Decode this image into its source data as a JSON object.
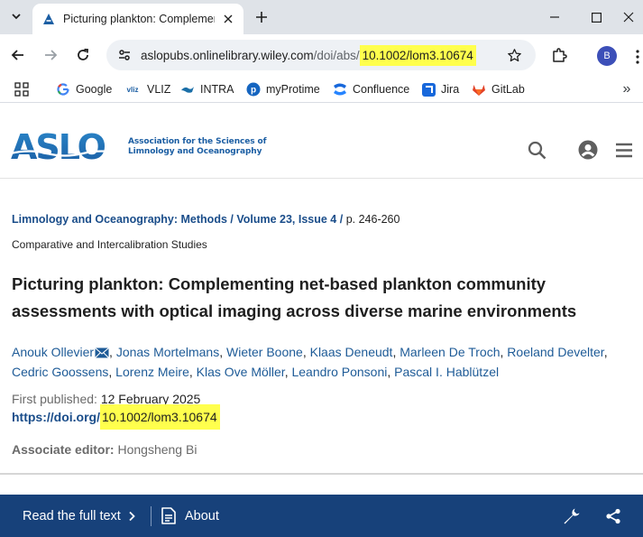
{
  "browser": {
    "tab": {
      "title": "Picturing plankton: Complemen",
      "favicon": "aslo-a-icon"
    },
    "address_bar": {
      "url_host": "aslopubs.onlinelibrary.wiley.com",
      "url_path": "/doi/abs/",
      "url_doi": "10.1002/lom3.10674"
    },
    "profile_initial": "B",
    "bookmarks": [
      {
        "label": "Google",
        "icon": "google-icon"
      },
      {
        "label": "VLIZ",
        "icon": "vliz-icon"
      },
      {
        "label": "INTRA",
        "icon": "intra-icon"
      },
      {
        "label": "myProtime",
        "icon": "myprotime-icon"
      },
      {
        "label": "Confluence",
        "icon": "confluence-icon"
      },
      {
        "label": "Jira",
        "icon": "jira-icon"
      },
      {
        "label": "GitLab",
        "icon": "gitlab-icon"
      }
    ],
    "bookmarks_overflow": "»"
  },
  "site": {
    "logo_line1": "Association for the Sciences of",
    "logo_line2": "Limnology and Oceanography",
    "logo_word": "ASLO"
  },
  "article": {
    "journal": "Limnology and Oceanography: Methods",
    "volume": "Volume 23, Issue 4",
    "breadcrumb_sep1": " / ",
    "breadcrumb_sep2": " / ",
    "pages": " p. 246-260",
    "section": "Comparative and Intercalibration Studies",
    "title": "Picturing plankton: Complementing net-based plankton community assessments with optical imaging across diverse marine environments",
    "authors": [
      "Anouk Ollevier",
      "Jonas Mortelmans",
      "Wieter Boone",
      "Klaas Deneudt",
      "Marleen De Troch",
      "Roeland Develter",
      "Cedric Goossens",
      "Lorenz Meire",
      "Klas Ove Möller",
      "Leandro Ponsoni",
      "Pascal I. Hablützel"
    ],
    "first_published_label": "First published: ",
    "first_published_date": "12 February 2025",
    "doi_prefix": "https://doi.org/",
    "doi_suffix": "10.1002/lom3.10674",
    "associate_editor_label": "Associate editor: ",
    "associate_editor": "Hongsheng Bi"
  },
  "bottom_bar": {
    "read_full_text": "Read the full text",
    "about": "About"
  },
  "colors": {
    "brand_blue": "#17417a",
    "link_blue": "#1a4d8a",
    "highlight_yellow": "#ffff4d",
    "aslo_blue": "#1b5ea3"
  }
}
